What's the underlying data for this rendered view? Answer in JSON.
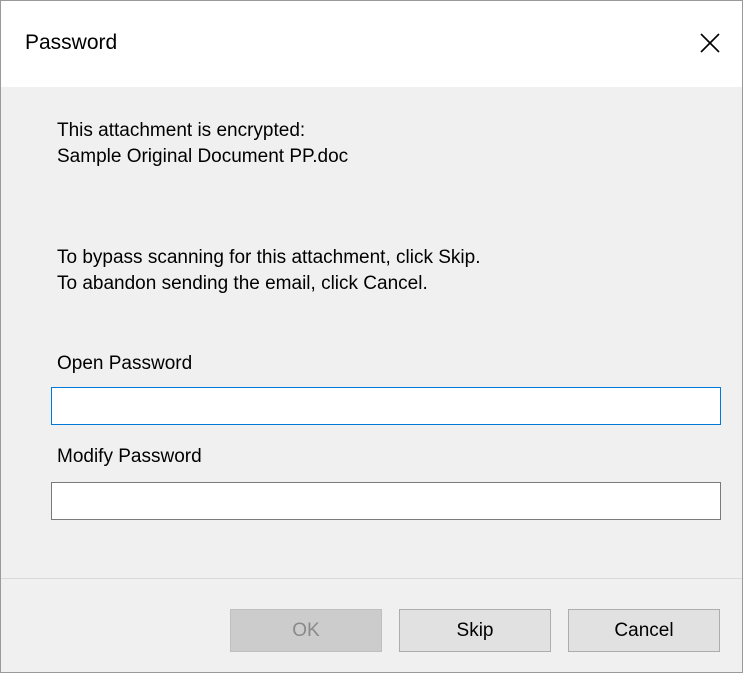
{
  "dialog": {
    "title": "Password",
    "close_icon": "close-icon"
  },
  "message": {
    "line1": "This attachment is encrypted:",
    "line2": "Sample Original Document PP.doc",
    "line3": "To bypass scanning for this attachment, click Skip.",
    "line4": "To abandon sending the email, click Cancel."
  },
  "fields": {
    "open_password_label": "Open Password",
    "open_password_value": "",
    "modify_password_label": "Modify Password",
    "modify_password_value": ""
  },
  "buttons": {
    "ok_label": "OK",
    "skip_label": "Skip",
    "cancel_label": "Cancel"
  },
  "colors": {
    "focus_border": "#0078d7",
    "dialog_background": "#f0f0f0",
    "disabled_text": "#8a8a8a"
  }
}
